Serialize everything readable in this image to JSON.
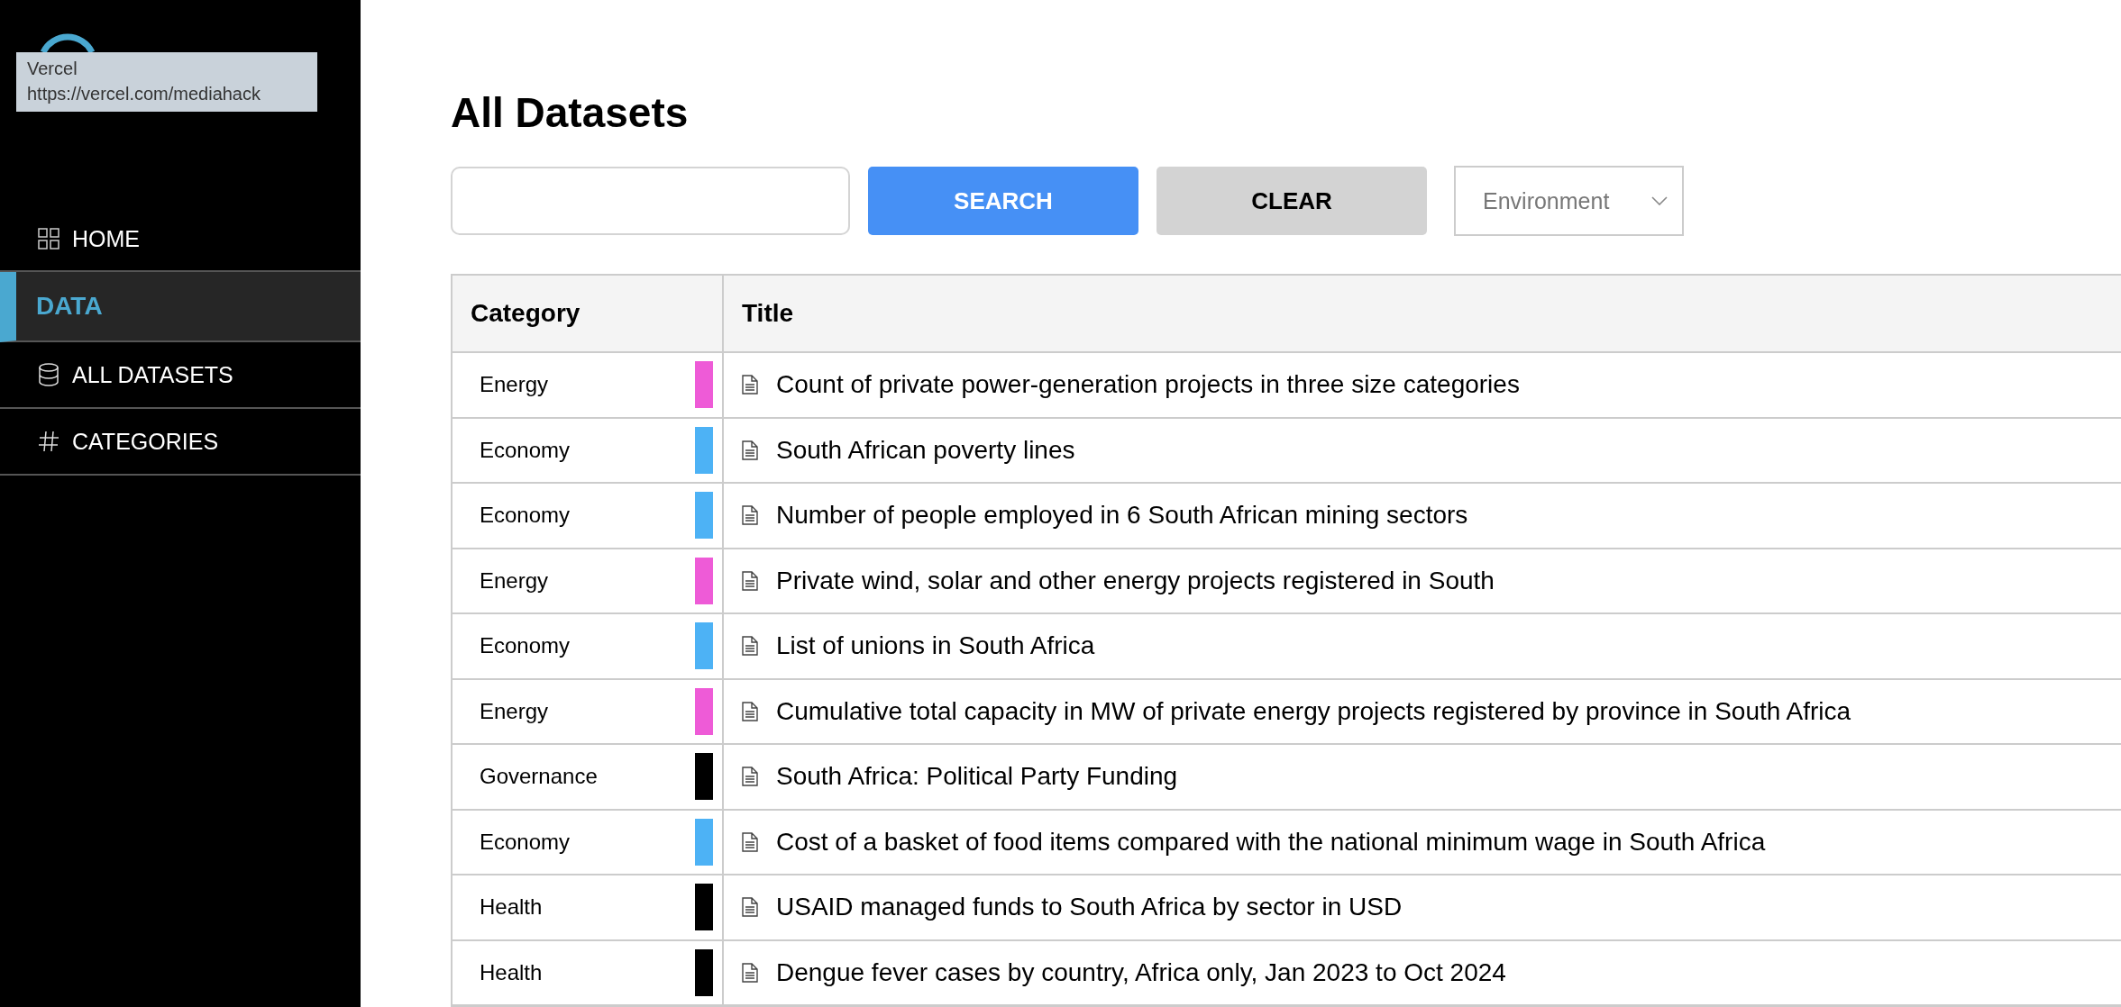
{
  "tooltip": {
    "title": "Vercel",
    "url": "https://vercel.com/mediahack"
  },
  "sidebar": {
    "items": [
      {
        "label": "HOME",
        "kind": "home",
        "selected": false
      },
      {
        "label": "DATA",
        "kind": "section",
        "selected": true
      },
      {
        "label": "ALL DATASETS",
        "kind": "datasets",
        "selected": false
      },
      {
        "label": "CATEGORIES",
        "kind": "categories",
        "selected": false
      }
    ]
  },
  "page_title": "All Datasets",
  "search": {
    "search_button": "SEARCH",
    "clear_button": "CLEAR",
    "category_select": "Environment"
  },
  "table": {
    "columns": [
      "Category",
      "Title"
    ],
    "rows": [
      {
        "category": "Energy",
        "color": "#ee5bd7",
        "title": "Count of private power-generation projects in three size categories"
      },
      {
        "category": "Economy",
        "color": "#4db2f5",
        "title": "South African poverty lines"
      },
      {
        "category": "Economy",
        "color": "#4db2f5",
        "title": "Number of people employed in 6 South African mining sectors"
      },
      {
        "category": "Energy",
        "color": "#ee5bd7",
        "title": "Private wind, solar and other energy projects registered in South"
      },
      {
        "category": "Economy",
        "color": "#4db2f5",
        "title": "List of unions in South Africa"
      },
      {
        "category": "Energy",
        "color": "#ee5bd7",
        "title": "Cumulative total capacity in MW of private energy projects registered by province in South Africa"
      },
      {
        "category": "Governance",
        "color": "#000000",
        "title": "South Africa: Political Party Funding"
      },
      {
        "category": "Economy",
        "color": "#4db2f5",
        "title": "Cost of a basket of food items compared with the national minimum wage in South Africa"
      },
      {
        "category": "Health",
        "color": "#000000",
        "title": "USAID managed funds to South Africa by sector in USD"
      },
      {
        "category": "Health",
        "color": "#000000",
        "title": "Dengue fever cases by country, Africa only, Jan 2023 to Oct 2024"
      }
    ]
  }
}
